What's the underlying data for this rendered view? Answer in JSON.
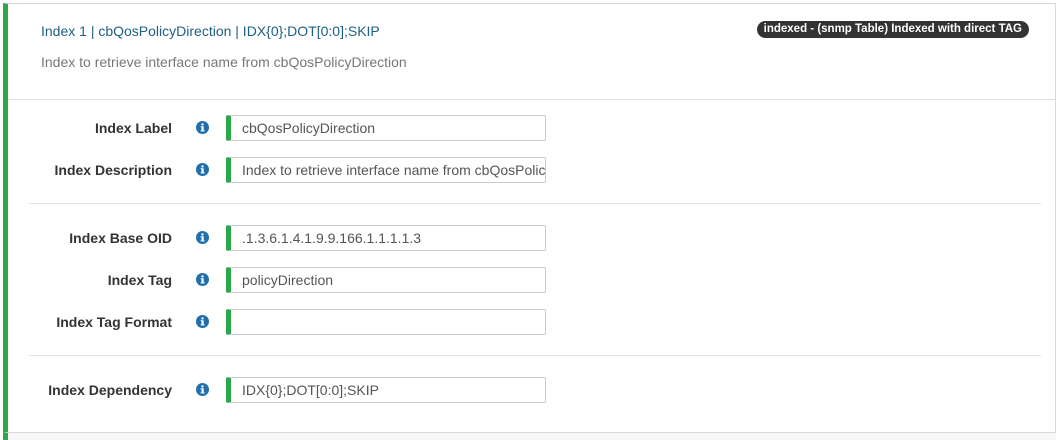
{
  "header": {
    "title": "Index 1 | cbQosPolicyDirection | IDX{0};DOT[0:0];SKIP",
    "subtitle": "Index to retrieve interface name from cbQosPolicyDirection",
    "badge": "indexed - (snmp Table) Indexed with direct TAG"
  },
  "fields": {
    "index_label": {
      "label": "Index Label",
      "value": "cbQosPolicyDirection"
    },
    "index_description": {
      "label": "Index Description",
      "value": "Index to retrieve interface name from cbQosPolicyDirection"
    },
    "index_base_oid": {
      "label": "Index Base OID",
      "value": ".1.3.6.1.4.1.9.9.166.1.1.1.1.3"
    },
    "index_tag": {
      "label": "Index Tag",
      "value": "policyDirection"
    },
    "index_tag_format": {
      "label": "Index Tag Format",
      "value": ""
    },
    "index_dependency": {
      "label": "Index Dependency",
      "value": "IDX{0};DOT[0:0];SKIP"
    }
  },
  "icons": {
    "info": "info-circle-icon"
  },
  "colors": {
    "accent": "#2aa84a",
    "info": "#1f6fae",
    "title": "#1f5f86",
    "badge": "#333333"
  }
}
